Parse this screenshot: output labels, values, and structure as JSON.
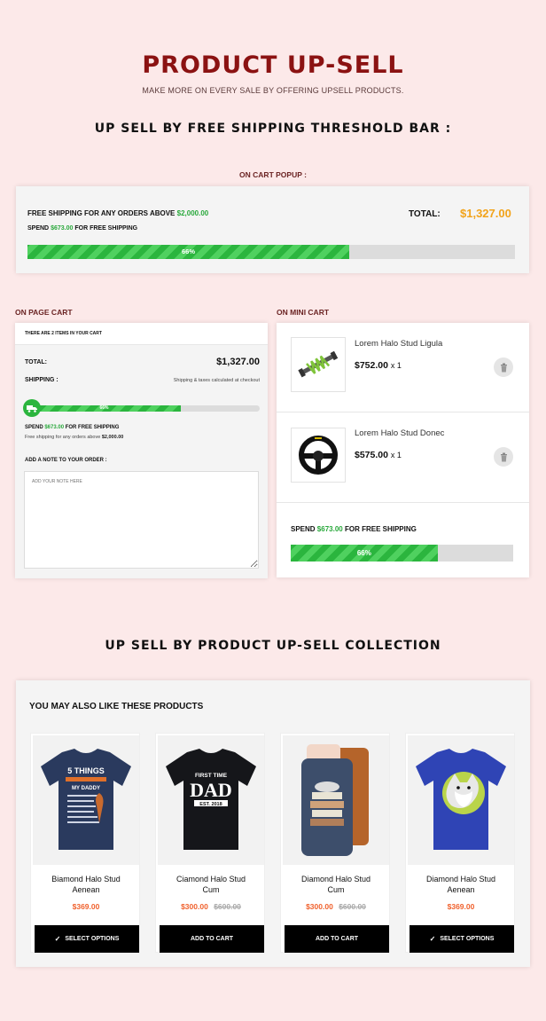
{
  "header": {
    "title": "PRODUCT UP-SELL",
    "subtitle": "MAKE MORE ON EVERY SALE BY OFFERING UPSELL PRODUCTS.",
    "section1": "UP SELL BY FREE SHIPPING THRESHOLD BAR :",
    "section2": "UP SELL BY PRODUCT UP-SELL COLLECTION"
  },
  "popup": {
    "label": "ON CART POPUP :",
    "threshold_text": "FREE SHIPPING FOR ANY ORDERS ABOVE",
    "threshold_amount": "$2,000.00",
    "spend_prefix": "SPEND",
    "spend_amount": "$673.00",
    "spend_suffix": "FOR FREE SHIPPING",
    "total_label": "TOTAL:",
    "total_value": "$1,327.00",
    "progress": 0.66,
    "progress_label": "66%"
  },
  "page_cart": {
    "label": "ON PAGE CART",
    "items_text": "THERE ARE 2 ITEMS IN YOUR CART",
    "total_label": "TOTAL:",
    "total_value": "$1,327.00",
    "shipping_label": "SHIPPING :",
    "shipping_note": "Shipping & taxes calculated at checkout",
    "progress": 0.66,
    "progress_label": "66%",
    "spend_prefix": "SPEND",
    "spend_amount": "$673.00",
    "spend_suffix": "FOR FREE SHIPPING",
    "threshold_text": "Free shipping for any orders above",
    "threshold_amount": "$2,000.00",
    "note_label": "ADD A NOTE TO YOUR ORDER :",
    "note_placeholder": "ADD YOUR NOTE HERE"
  },
  "mini_cart": {
    "label": "ON MINI CART",
    "items": [
      {
        "name": "Lorem Halo Stud Ligula",
        "price": "$752.00",
        "qty": "x 1",
        "icon": "coilover-icon"
      },
      {
        "name": "Lorem Halo Stud Donec",
        "price": "$575.00",
        "qty": "x 1",
        "icon": "steering-wheel-icon"
      }
    ],
    "spend_prefix": "SPEND",
    "spend_amount": "$673.00",
    "spend_suffix": "FOR FREE SHIPPING",
    "progress": 0.66,
    "progress_label": "66%"
  },
  "collection": {
    "title": "YOU MAY ALSO LIKE THESE PRODUCTS",
    "products": [
      {
        "name": "Biamond Halo Stud Aenean",
        "price": "$369.00",
        "old_price": "",
        "button": "SELECT OPTIONS",
        "icon": "tshirt-5-things-icon"
      },
      {
        "name": "Ciamond Halo Stud Cum",
        "price": "$300.00",
        "old_price": "$600.00",
        "button": "ADD TO CART",
        "icon": "tshirt-dad-icon"
      },
      {
        "name": "Diamond Halo Stud Cum",
        "price": "$300.00",
        "old_price": "$600.00",
        "button": "ADD TO CART",
        "icon": "phone-sleeve-icon"
      },
      {
        "name": "Diamond Halo Stud Aenean",
        "price": "$369.00",
        "old_price": "",
        "button": "SELECT OPTIONS",
        "icon": "tshirt-husky-icon"
      }
    ]
  },
  "colors": {
    "title": "#8b1212",
    "green": "#29a83b",
    "orange_total": "#f2a31a",
    "price": "#f0612d",
    "background": "#fce9e9"
  }
}
